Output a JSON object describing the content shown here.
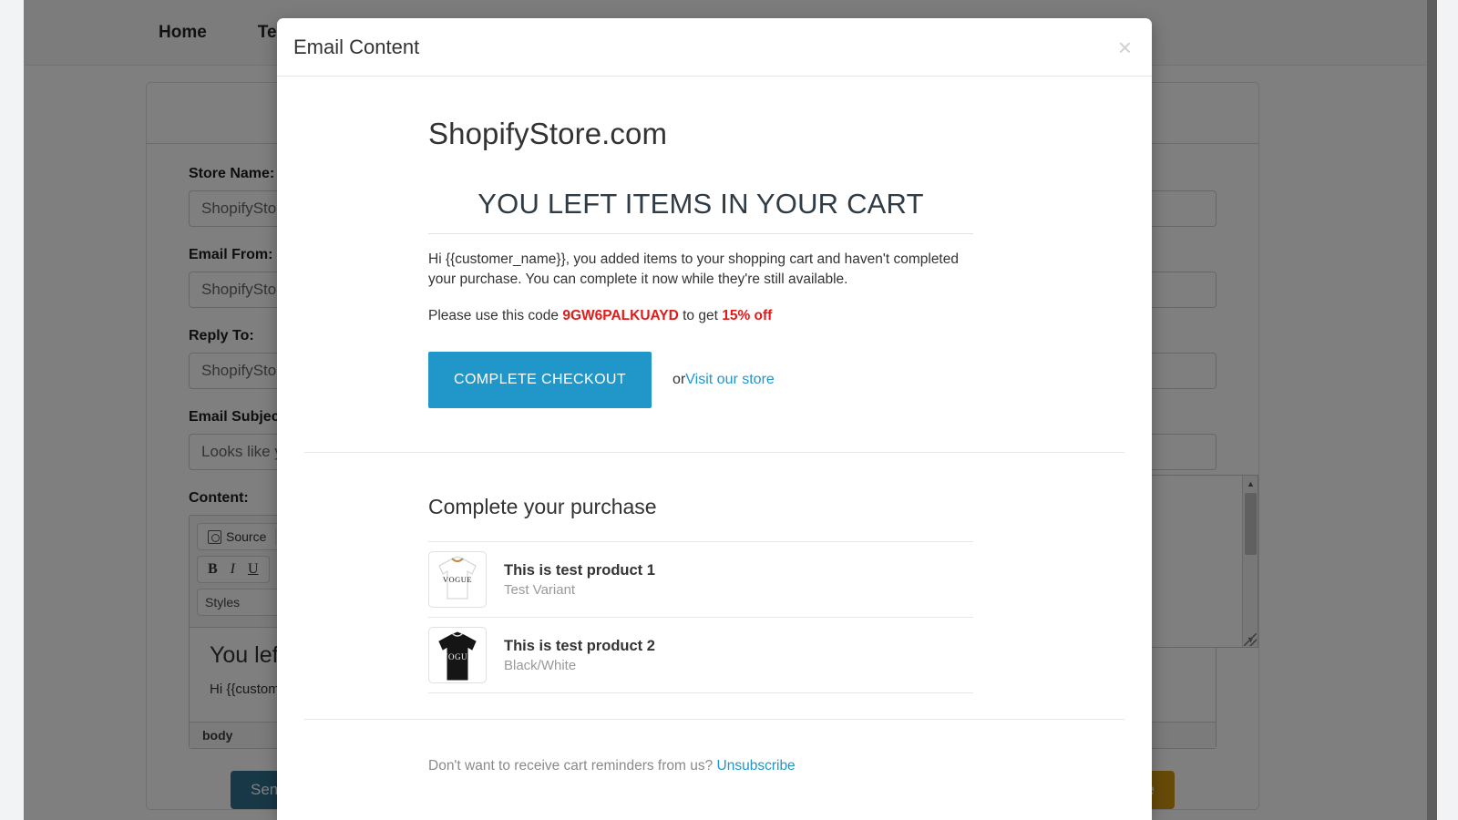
{
  "background": {
    "nav": {
      "items": [
        {
          "label": "Home",
          "name": "nav-home"
        },
        {
          "label": "Temp",
          "name": "nav-templates"
        }
      ]
    },
    "form": {
      "store_name_label": "Store Name:",
      "store_name_value": "ShopifyStore",
      "email_from_label": "Email From:",
      "email_from_value": "ShopifyStore",
      "reply_to_label": "Reply To:",
      "reply_to_value": "ShopifyStore",
      "email_subject_label": "Email Subject:",
      "email_subject_value": "Looks like yo",
      "content_label": "Content:"
    },
    "editor": {
      "source_label": "Source",
      "bold_label": "B",
      "italic_label": "I",
      "underline_label": "U",
      "styles_label": "Styles",
      "styles_caret": "▾",
      "preview_heading": "You left",
      "preview_line1": "Hi {{custome",
      "status_path": "body"
    },
    "buttons": {
      "send_test_label": "Send a Test E",
      "update_label": "Update"
    },
    "colors": {
      "send_test": "#31708f",
      "update": "#cf9411"
    }
  },
  "modal": {
    "title": "Email Content",
    "close_label": "×"
  },
  "email": {
    "brand": "ShopifyStore.com",
    "headline": "YOU LEFT ITEMS IN YOUR CART",
    "intro": "Hi {{customer_name}}, you added items to your shopping cart and haven't completed your purchase. You can complete it now while they're still available.",
    "code_prefix": "Please use this code ",
    "code": "9GW6PALKUAYD",
    "code_middle": " to get ",
    "discount": "15% off",
    "cta_button": "COMPLETE CHECKOUT",
    "cta_or": "or ",
    "cta_link": "Visit our store",
    "purchase_title": "Complete your purchase",
    "products": [
      {
        "name": "This is test product 1",
        "variant": "Test Variant",
        "shirt_color": "#ffffff",
        "print_color": "#1a1a1a",
        "print_text": "VOGUE"
      },
      {
        "name": "This is test product 2",
        "variant": "Black/White",
        "shirt_color": "#151515",
        "print_color": "#ffffff",
        "print_text": "VOGUE"
      }
    ],
    "footer_text": "Don't want to receive cart reminders from us? ",
    "unsubscribe_label": "Unsubscribe",
    "colors": {
      "cta": "#2196c9",
      "link": "#2196c9",
      "accent_red": "#e01b1b"
    }
  }
}
